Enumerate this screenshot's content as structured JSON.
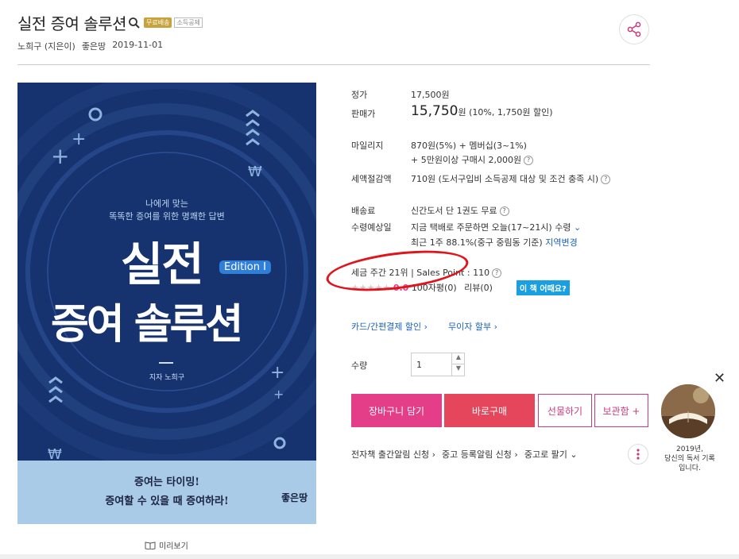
{
  "product": {
    "title": "실전 증여 솔루션",
    "badge_free_shipping": "무료배송",
    "badge_tax": "소득공제",
    "author": "노희구 (지은이)",
    "publisher": "좋은땅",
    "date": "2019-11-01"
  },
  "cover": {
    "subtitle1": "나에게 맞는",
    "subtitle2": "똑똑한 증여를 위한 명쾌한 답변",
    "title_line1": "실전",
    "edition": "Edition I",
    "title_line2": "증여 솔루션",
    "author": "지자 노희구",
    "slogan1": "증여는 타이밍!",
    "slogan2": "증여할 수 있을 때 증여하라!",
    "publisher_logo": "좋은땅"
  },
  "preview_label": "미리보기",
  "pricing": {
    "list_price_label": "정가",
    "list_price": "17,500원",
    "sale_price_label": "판매가",
    "sale_price": "15,750",
    "sale_unit": "원",
    "sale_detail": "(10%, 1,750원 할인)",
    "mileage_label": "마일리지",
    "mileage_line1": "870원(5%) + 멤버십(3~1%)",
    "mileage_line2": "+ 5만원이상 구매시 2,000원",
    "tax_label": "세액절감액",
    "tax_value": "710원 (도서구입비 소득공제 대상 및 조건 충족 시)"
  },
  "shipping": {
    "fee_label": "배송료",
    "fee_value": "신간도서 단 1권도 무료",
    "eta_label": "수령예상일",
    "eta_line1": "지금 택배로 주문하면 오늘(17~21시) 수령",
    "eta_line2": "최근 1주 88.1%(중구 중림동 기준)",
    "region_change": "지역변경"
  },
  "ranking": {
    "text": "세금 주간 21위  |  Sales Point : 110",
    "rating": "0.0",
    "reviews_100": "100자평(0)",
    "reviews": "리뷰(0)",
    "ask_badge": "이 책 어때요?"
  },
  "links": {
    "card_discount": "카드/간편결제 할인 ›",
    "installment": "무이자 할부 ›"
  },
  "quantity": {
    "label": "수량",
    "value": "1"
  },
  "buttons": {
    "cart": "장바구니 담기",
    "buy": "바로구매",
    "gift": "선물하기",
    "save": "보관함 +"
  },
  "bottom_links": {
    "ebook_alert": "전자책 출간알림 신청 ›",
    "used_alert": "중고 등록알림 신청 ›",
    "sell_used": "중고로 팔기 ⌄"
  },
  "promo": {
    "line1": "2019년,",
    "line2": "당신의 독서 기록",
    "line3": "입니다."
  },
  "colors": {
    "cart": "#e43e89",
    "buy": "#e5465b",
    "cover_bg": "#16336f",
    "annotation": "#e0141b"
  }
}
